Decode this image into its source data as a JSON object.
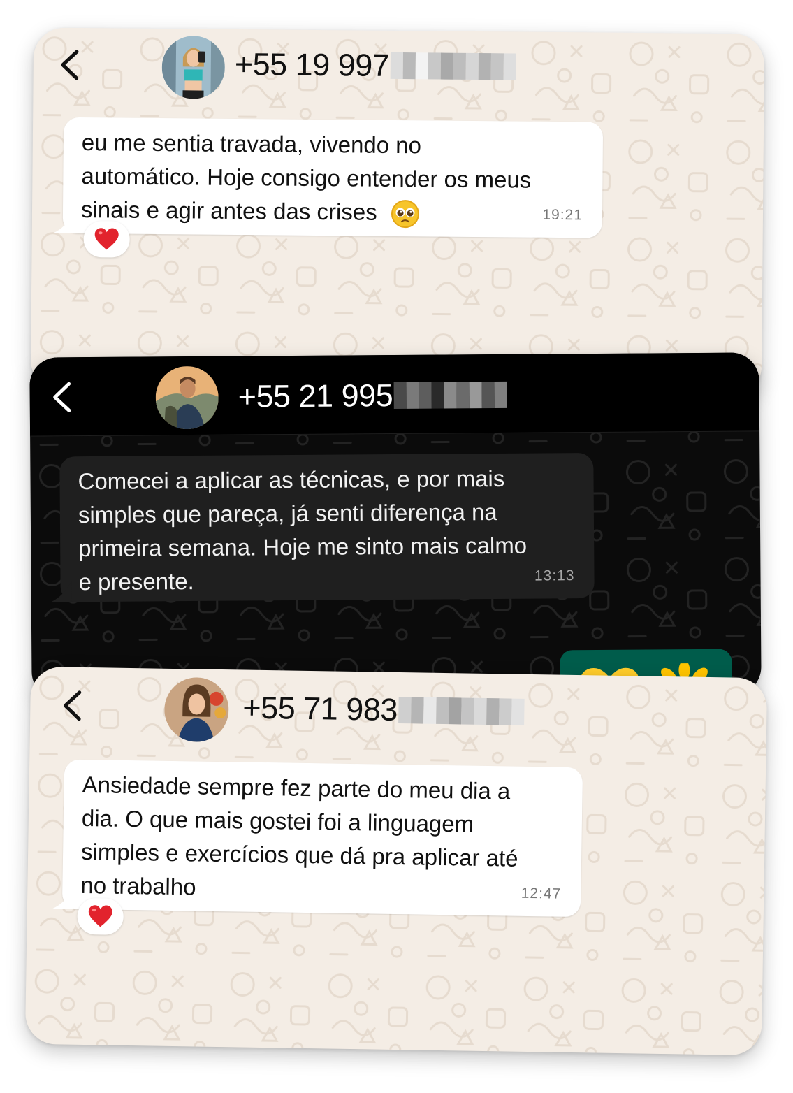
{
  "cards": [
    {
      "theme": "light",
      "contact": {
        "number_prefix": "+55 19 997",
        "avatar": "woman-gym-selfie-avatar"
      },
      "message": {
        "lines": [
          "eu me sentia travada, vivendo no",
          "automático. Hoje consigo entender os meus",
          "sinais e agir antes das crises"
        ],
        "emoji": "pleading-face",
        "time": "19:21",
        "reaction": "red-heart"
      }
    },
    {
      "theme": "dark",
      "contact": {
        "number_prefix": "+55 21 995",
        "avatar": "man-hiking-avatar"
      },
      "message": {
        "lines": [
          "Comecei a aplicar as técnicas, e por mais",
          "simples que pareça,  já senti diferença na",
          "primeira semana. Hoje me sinto mais calmo",
          "e presente."
        ],
        "time": "13:13"
      },
      "sent_message": {
        "emojis": [
          "yellow-heart",
          "sunflower"
        ]
      }
    },
    {
      "theme": "light",
      "contact": {
        "number_prefix": "+55 71 983",
        "avatar": "woman-smiling-avatar"
      },
      "message": {
        "lines": [
          "Ansiedade sempre fez parte do meu dia a",
          "dia. O que mais gostei foi a linguagem",
          "simples e exercícios que dá pra aplicar até",
          "no trabalho"
        ],
        "time": "12:47",
        "reaction": "red-heart"
      }
    }
  ],
  "colors": {
    "light_chat_bg": "#f4ede5",
    "dark_chat_bg": "#0b0b0b",
    "dark_bubble": "#1f1f1f",
    "sent_bubble_dark": "#005c4b",
    "heart_red": "#e2232d"
  }
}
